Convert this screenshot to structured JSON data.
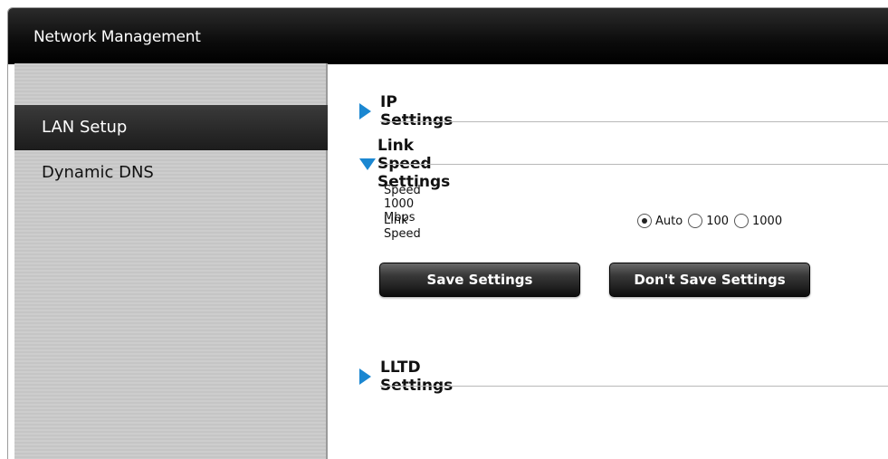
{
  "window": {
    "title": "Network Management"
  },
  "sidebar": {
    "items": [
      {
        "label": "LAN Setup",
        "active": true
      },
      {
        "label": "Dynamic DNS",
        "active": false
      }
    ]
  },
  "sections": {
    "ip": {
      "title": "IP Settings",
      "expanded": false
    },
    "link_speed": {
      "title": "Link Speed Settings",
      "expanded": true,
      "speed_text": "Speed 1000 Mbps",
      "link_speed_label": "Link Speed",
      "options": [
        {
          "label": "Auto",
          "selected": true
        },
        {
          "label": "100",
          "selected": false
        },
        {
          "label": "1000",
          "selected": false
        }
      ],
      "save_label": "Save Settings",
      "dont_save_label": "Don't Save Settings"
    },
    "lltd": {
      "title": "LLTD Settings",
      "expanded": false
    }
  },
  "colors": {
    "accent_triangle": "#1b87d1",
    "title_bar": "#000000",
    "sidebar_active": "#2a2a2a"
  },
  "icons": [
    "collapse-arrow-icon",
    "expand-arrow-icon"
  ]
}
